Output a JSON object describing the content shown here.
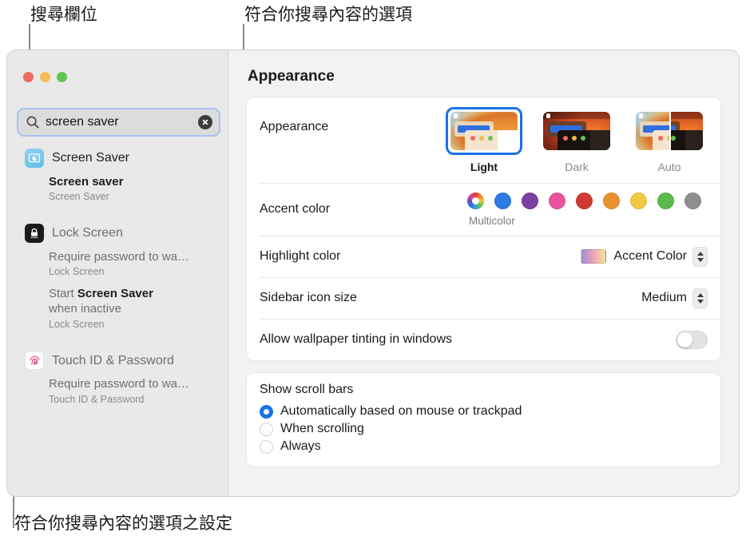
{
  "annotations": {
    "search_field": "搜尋欄位",
    "matching_options": "符合你搜尋內容的選項",
    "matching_settings": "符合你搜尋內容的選項之設定"
  },
  "window": {
    "traffic_lights": [
      "close-button",
      "minimize-button",
      "zoom-button"
    ]
  },
  "search": {
    "icon": "search-icon",
    "value": "screen saver",
    "placeholder": "Search",
    "clear_icon": "clear-icon"
  },
  "sidebar": {
    "groups": [
      {
        "icon": "screen-saver-icon",
        "title": "Screen Saver",
        "active": true,
        "results": [
          {
            "text": "Screen saver",
            "bold": true,
            "sub": "Screen Saver"
          }
        ]
      },
      {
        "icon": "lock-screen-icon",
        "title": "Lock Screen",
        "active": false,
        "results": [
          {
            "text": "Require password to wa…",
            "bold": false,
            "sub": "Lock Screen"
          },
          {
            "text_pre": "Start ",
            "highlight": "Screen Saver",
            "text_post": "when inactive",
            "sub": "Lock Screen"
          }
        ]
      },
      {
        "icon": "touch-id-icon",
        "title": "Touch ID & Password",
        "active": false,
        "results": [
          {
            "text": "Require password to wa…",
            "bold": false,
            "sub": "Touch ID & Password"
          }
        ]
      }
    ]
  },
  "panel": {
    "title": "Appearance",
    "appearance": {
      "label": "Appearance",
      "options": [
        {
          "name": "Light",
          "selected": true
        },
        {
          "name": "Dark",
          "selected": false
        },
        {
          "name": "Auto",
          "selected": false
        }
      ]
    },
    "accent": {
      "label": "Accent color",
      "caption": "Multicolor",
      "selected_index": 0,
      "swatches": [
        {
          "name": "Multicolor",
          "color": "multicolor"
        },
        {
          "name": "Blue",
          "color": "#2f7ae5"
        },
        {
          "name": "Purple",
          "color": "#7d3fa0"
        },
        {
          "name": "Pink",
          "color": "#e8539c"
        },
        {
          "name": "Red",
          "color": "#cf3b34"
        },
        {
          "name": "Orange",
          "color": "#e8912e"
        },
        {
          "name": "Yellow",
          "color": "#f2c944"
        },
        {
          "name": "Green",
          "color": "#5aba4a"
        },
        {
          "name": "Graphite",
          "color": "#8e8e8e"
        }
      ]
    },
    "highlight": {
      "label": "Highlight color",
      "value": "Accent Color"
    },
    "sidebar_icon_size": {
      "label": "Sidebar icon size",
      "value": "Medium"
    },
    "wallpaper_tinting": {
      "label": "Allow wallpaper tinting in windows",
      "on": false
    },
    "scroll_bars": {
      "title": "Show scroll bars",
      "options": [
        {
          "label": "Automatically based on mouse or trackpad",
          "selected": true
        },
        {
          "label": "When scrolling",
          "selected": false
        },
        {
          "label": "Always",
          "selected": false
        }
      ]
    }
  }
}
